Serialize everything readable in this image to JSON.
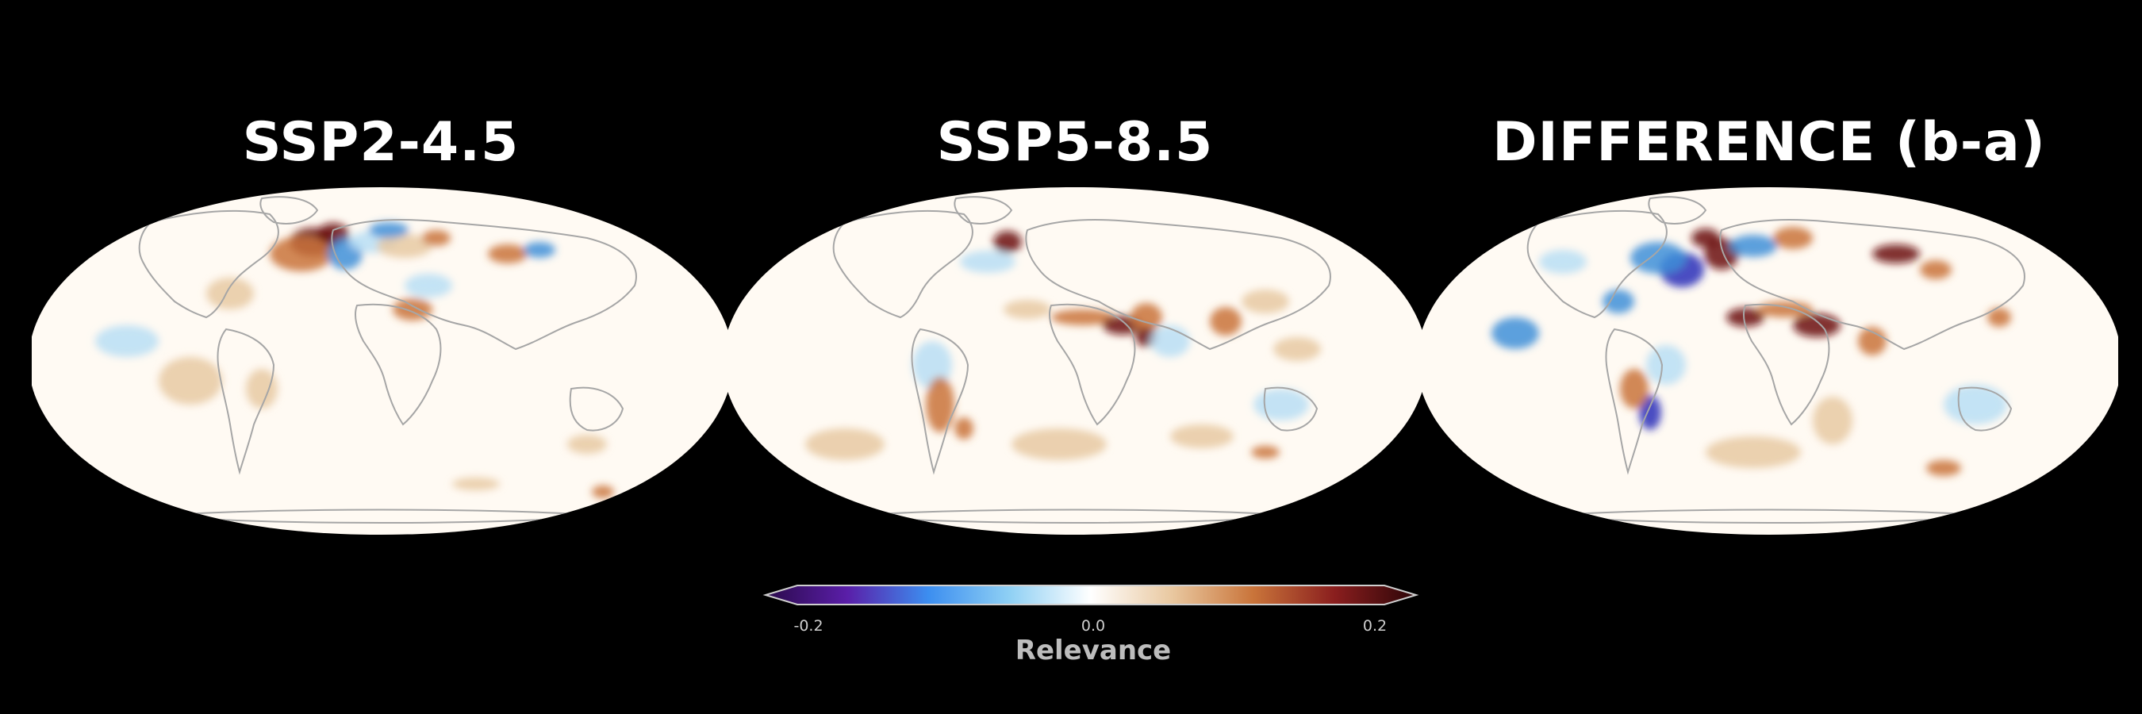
{
  "panels": [
    {
      "title": "SSP2-4.5"
    },
    {
      "title": "SSP5-8.5"
    },
    {
      "title": "DIFFERENCE (b-a)"
    }
  ],
  "colorbar": {
    "label": "Relevance",
    "ticks": [
      "-0.2",
      "0.0",
      "0.2"
    ],
    "range": [
      -0.2,
      0.2
    ],
    "colors": [
      "#2a0a4a",
      "#5a1ea8",
      "#3c8ef0",
      "#8fd0f4",
      "#ffffff",
      "#e9c8a0",
      "#c9743a",
      "#8a1e1e",
      "#2b0508"
    ]
  },
  "colors": {
    "background": "#000000",
    "ocean_base": "#fffaf3",
    "coast": "#a6a6a6",
    "positive_light": "#e8c9a2",
    "positive_mid": "#c9733a",
    "positive_strong": "#6b0f12",
    "negative_light": "#b9def5",
    "negative_mid": "#3e8fd8",
    "negative_strong": "#2a2fb8"
  }
}
